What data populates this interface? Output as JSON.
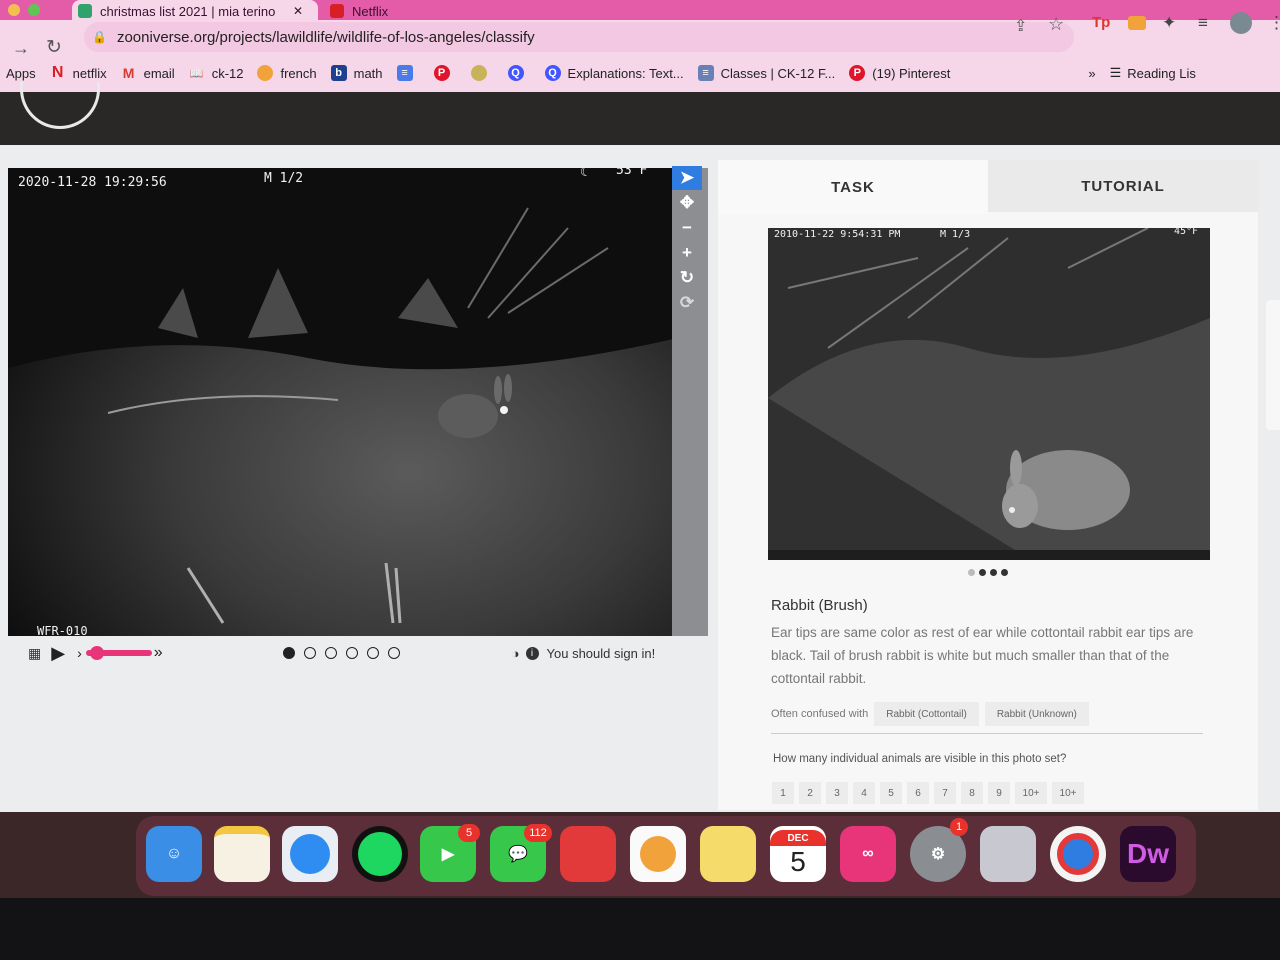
{
  "browser": {
    "tabs": [
      {
        "label": "christmas list 2021 | mia terino",
        "close": "✕"
      },
      {
        "label": "Netflix"
      }
    ],
    "url": "zooniverse.org/projects/lawildlife/wildlife-of-los-angeles/classify",
    "bookmarks": [
      {
        "label": "Apps"
      },
      {
        "label": "netflix"
      },
      {
        "label": "email"
      },
      {
        "label": "ck-12"
      },
      {
        "label": "french"
      },
      {
        "label": "math"
      },
      {
        "label": "Explanations: Text..."
      },
      {
        "label": "Classes | CK-12 F..."
      },
      {
        "label": "(19) Pinterest"
      }
    ],
    "overflow": "»",
    "reading_list": "Reading Lis"
  },
  "viewer": {
    "timestamp": "2020-11-28 19:29:56",
    "frame": "M 1/2",
    "temp": "53°F",
    "camera_id": "WFR-010",
    "sign_in": "You should sign in!",
    "frames_total": 6,
    "frame_selected": 1
  },
  "task": {
    "tab_task": "TASK",
    "tab_tutorial": "TUTORIAL",
    "ref_stamp": "2010-11-22 9:54:31 PM",
    "ref_frame": "M 1/3",
    "ref_temp": "45°F",
    "species": "Rabbit (Brush)",
    "description": "Ear tips are same color as rest of ear while cottontail rabbit ear tips are black. Tail of brush rabbit is white but much smaller than that of the cottontail rabbit.",
    "confused_label": "Often confused with",
    "confused": [
      "Rabbit (Cottontail)",
      "Rabbit (Unknown)"
    ],
    "question": "How many individual animals are visible in this photo set?",
    "answers": [
      "1",
      "2",
      "3",
      "4",
      "5",
      "6",
      "7",
      "8",
      "9",
      "10+",
      "10+"
    ]
  },
  "dock": {
    "calendar_month": "DEC",
    "calendar_day": "5",
    "facetime_badge": "5",
    "messages_badge": "112",
    "settings_badge": "1",
    "dw_label": "Dw"
  },
  "colors": {
    "tabbar": "#e45ca8",
    "toolbar": "#f6d7ea",
    "tool_active": "#2f7de0"
  }
}
